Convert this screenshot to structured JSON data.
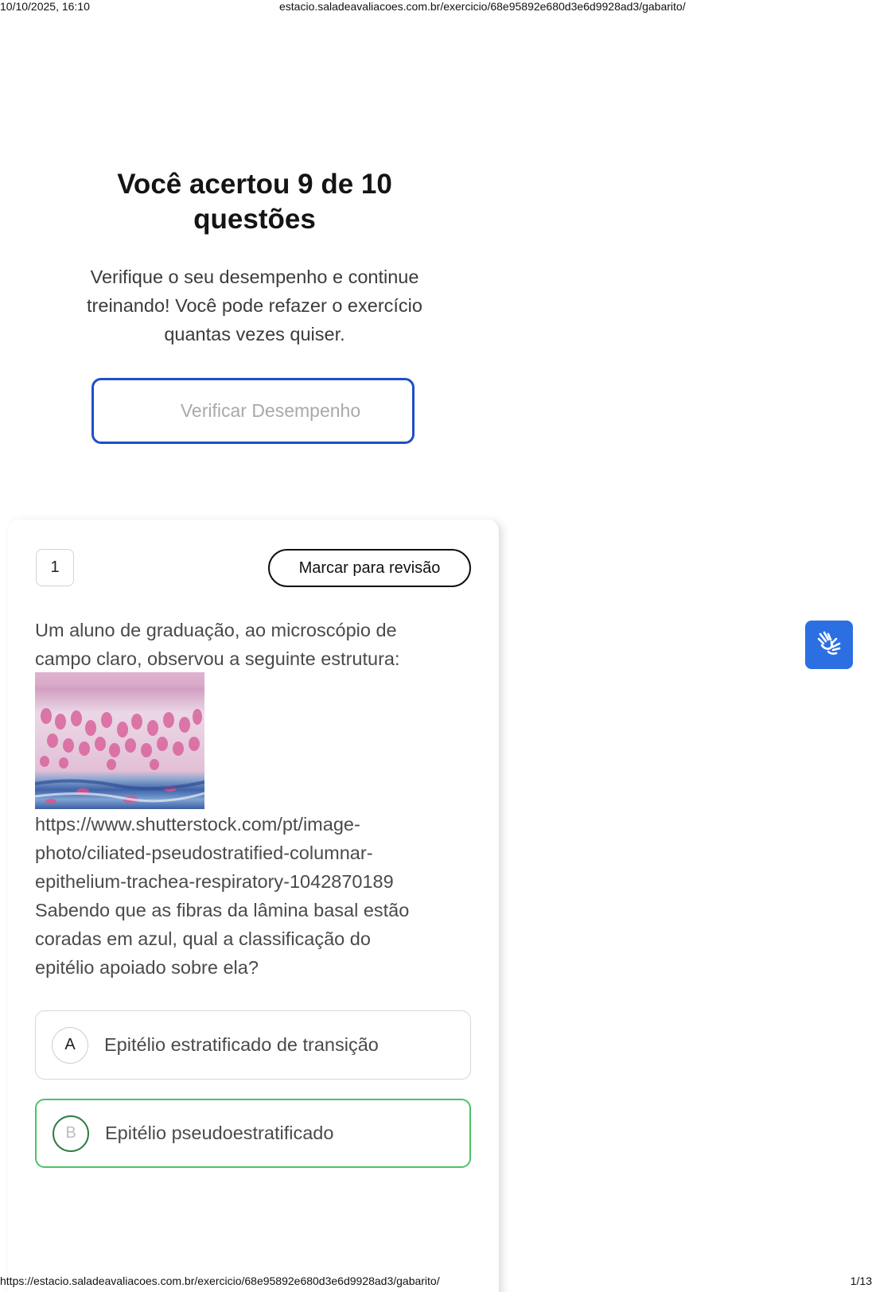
{
  "print": {
    "datetime": "10/10/2025, 16:10",
    "header_url": "estacio.saladeavaliacoes.com.br/exercicio/68e95892e680d3e6d9928ad3/gabarito/",
    "footer_url": "https://estacio.saladeavaliacoes.com.br/exercicio/68e95892e680d3e6d9928ad3/gabarito/",
    "page_counter": "1/13"
  },
  "result": {
    "title_line1": "Você acertou 9 de 10",
    "title_line2": "questões",
    "sub_line1": "Verifique o seu desempenho e continue",
    "sub_line2": "treinando! Você pode refazer o exercício",
    "sub_line3": "quantas vezes quiser.",
    "button_label": "Verificar Desempenho"
  },
  "question": {
    "number": "1",
    "review_label": "Marcar para revisão",
    "intro_line1": "Um aluno de graduação, ao microscópio de",
    "intro_line2": "campo claro, observou a seguinte estrutura:",
    "url_line1": "https://www.shutterstock.com/pt/image-",
    "url_line2": "photo/ciliated-pseudostratified-columnar-",
    "url_line3": "epithelium-trachea-respiratory-1042870189",
    "body_line1": "Sabendo que as fibras da lâmina basal estão",
    "body_line2": "coradas em azul, qual a classificação do",
    "body_line3": "epitélio apoiado sobre ela?",
    "options": [
      {
        "letter": "A",
        "text": "Epitélio estratificado de transição"
      },
      {
        "letter": "B",
        "text": "Epitélio pseudoestratificado"
      }
    ]
  },
  "icons": {
    "accessibility": "sign-language-hands-icon"
  },
  "colors": {
    "primary_blue": "#1f4fc7",
    "correct_green": "#4dc26a",
    "a11y_blue": "#2c6fe3"
  }
}
